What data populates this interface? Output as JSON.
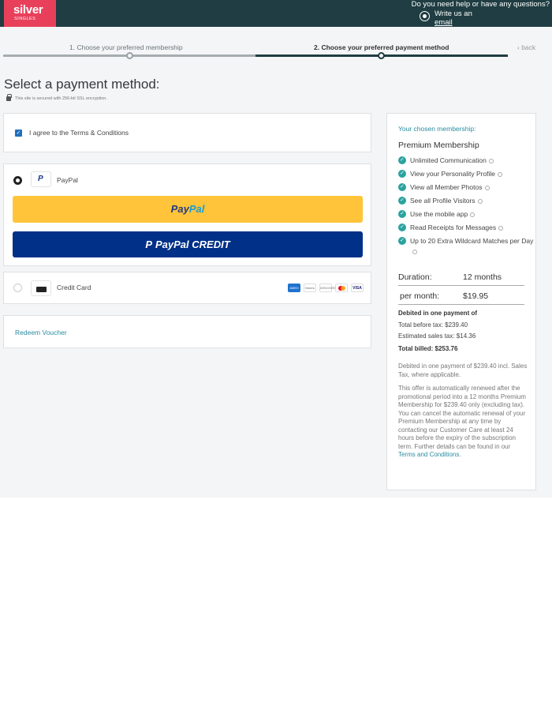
{
  "header": {
    "logo_text": "silver",
    "logo_subtext": "SINGLES",
    "help_question": "Do you need help or have any questions?",
    "write_us": "Write us an",
    "email_link": "email"
  },
  "steps": {
    "step1": "1. Choose your preferred membership",
    "step2": "2. Choose your preferred payment method",
    "back": "‹ back"
  },
  "page": {
    "title": "Select a payment method:",
    "ssl_note": "This site is secured with 256-bit SSL encryption."
  },
  "terms": {
    "checked": true,
    "label": "I agree to the Terms & Conditions"
  },
  "payment": {
    "paypal_label": "PayPal",
    "paypal_btn_pay": "Pay",
    "paypal_btn_pal": "Pal",
    "paypal_credit_btn": "PayPal CREDIT",
    "credit_card_label": "Credit Card",
    "card_logos": [
      "AMEX",
      "Diners",
      "DISCOVER",
      "Mastercard",
      "VISA"
    ],
    "voucher_link": "Redeem Voucher"
  },
  "summary": {
    "chosen_label": "Your chosen membership:",
    "plan": "Premium Membership",
    "features": [
      "Unlimited Communication",
      "View your Personality Profile",
      "View all Member Photos",
      "See all Profile Visitors",
      "Use the mobile app",
      "Read Receipts for Messages",
      "Up to 20 Extra Wildcard Matches per Day"
    ],
    "duration_label": "Duration:",
    "duration_value": "12 months",
    "per_month_label": "per month:",
    "per_month_value": "$19.95",
    "debited_title": "Debited in one payment of",
    "total_before_tax": "Total before tax: $239.40",
    "estimated_tax": "Estimated sales tax: $14.36",
    "total_billed": "Total billed: $253.76",
    "note1": "Debited in one payment of $239.40 incl. Sales Tax, where applicable.",
    "note2": "This offer is automatically renewed after the promotional period into a 12 months Premium Membership for $239.40 only (excluding tax). You can cancel the automatic renewal of your Premium Membership at any time by contacting our Customer Care at least 24 hours before the expiry of the subscription term. Further details can be found in our",
    "terms_link": "Terms and Conditions",
    "period": "."
  },
  "colors": {
    "header_bg": "#1f3d42",
    "logo_bg": "#e8405b",
    "paypal_yellow": "#ffc439",
    "paypal_credit_blue": "#003087",
    "accent_teal": "#2a8ca0"
  }
}
